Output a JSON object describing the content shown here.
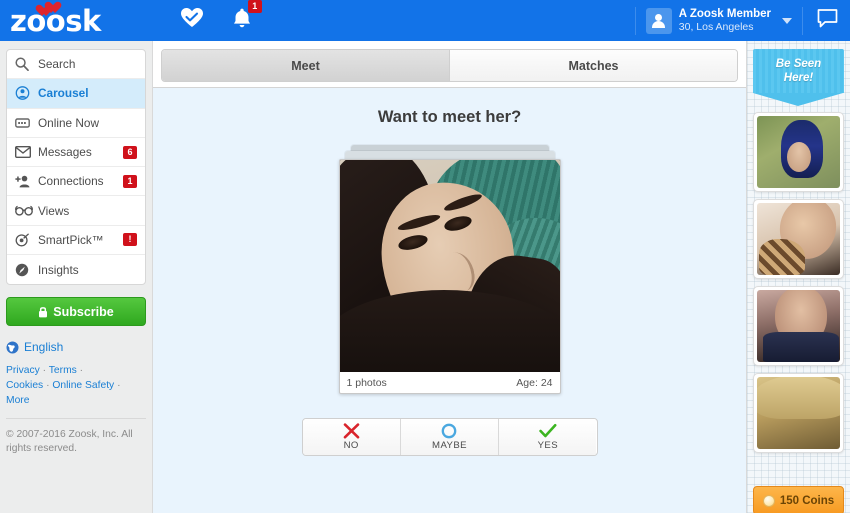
{
  "header": {
    "logo_text": "zoosk",
    "logo_icon": "double-heart-icon",
    "match_icon": "heart-check-icon",
    "notification_icon": "bell-icon",
    "notification_count": "1",
    "user_name": "A Zoosk Member",
    "user_sub": "30, Los Angeles",
    "avatar_icon": "person-silhouette-icon",
    "caret_icon": "chevron-down-icon",
    "chat_icon": "chat-bubble-icon"
  },
  "sidebar": {
    "items": [
      {
        "label": "Search",
        "icon": "search-icon",
        "badge": "",
        "active": false
      },
      {
        "label": "Carousel",
        "icon": "carousel-icon",
        "badge": "",
        "active": true
      },
      {
        "label": "Online Now",
        "icon": "online-now-icon",
        "badge": "",
        "active": false
      },
      {
        "label": "Messages",
        "icon": "envelope-icon",
        "badge": "6",
        "active": false
      },
      {
        "label": "Connections",
        "icon": "person-add-icon",
        "badge": "1",
        "active": false
      },
      {
        "label": "Views",
        "icon": "glasses-icon",
        "badge": "",
        "active": false
      },
      {
        "label": "SmartPick™",
        "icon": "target-icon",
        "badge": "!",
        "active": false
      },
      {
        "label": "Insights",
        "icon": "speedometer-icon",
        "badge": "",
        "active": false
      }
    ],
    "subscribe_label": "Subscribe",
    "subscribe_icon": "lock-icon",
    "language_label": "English",
    "language_icon": "globe-icon",
    "footer_links": [
      "Privacy",
      "Terms",
      "Cookies",
      "Online Safety",
      "More"
    ],
    "copyright": "© 2007-2016 Zoosk, Inc. All rights reserved."
  },
  "main": {
    "tabs": [
      {
        "label": "Meet",
        "selected": true
      },
      {
        "label": "Matches",
        "selected": false
      }
    ],
    "title": "Want to meet her?",
    "photo_count": "1 photos",
    "age": "Age: 24",
    "actions": [
      {
        "label": "NO",
        "icon": "x-mark-icon",
        "color": "#d9242c"
      },
      {
        "label": "MAYBE",
        "icon": "circle-icon",
        "color": "#4aa8e0"
      },
      {
        "label": "YES",
        "icon": "check-mark-icon",
        "color": "#3cb521"
      }
    ]
  },
  "rail": {
    "promo_line1": "Be Seen",
    "promo_line2": "Here!",
    "thumbnails": [
      {
        "name": "thumbnail-1"
      },
      {
        "name": "thumbnail-2"
      },
      {
        "name": "thumbnail-3"
      },
      {
        "name": "thumbnail-4"
      }
    ],
    "coins_label": "150 Coins",
    "coins_icon": "coin-icon"
  },
  "colors": {
    "brand_blue": "#1273e8",
    "accent_green": "#3cb521",
    "badge_red": "#d0111b",
    "stage_blue": "#e9f4fd",
    "coins_orange": "#f79a22"
  }
}
